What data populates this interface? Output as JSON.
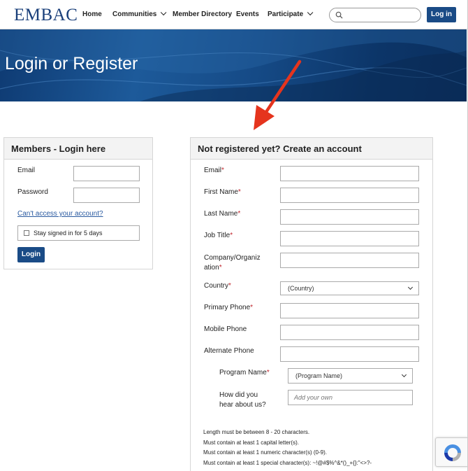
{
  "brand": {
    "logo_text": "EMBAC",
    "accent": "#1a4b86"
  },
  "nav": {
    "items": [
      {
        "label": "Home",
        "has_dropdown": false
      },
      {
        "label": "Communities",
        "has_dropdown": true
      },
      {
        "label": "Member Directory",
        "has_dropdown": false
      },
      {
        "label": "Events",
        "has_dropdown": false
      },
      {
        "label": "Participate",
        "has_dropdown": true
      }
    ],
    "search_placeholder": "",
    "login_button": "Log in"
  },
  "banner": {
    "title": "Login or Register"
  },
  "login_panel": {
    "title": "Members - Login here",
    "email_label": "Email",
    "password_label": "Password",
    "email_value": "",
    "password_value": "",
    "cant_access_link": "Can't access your account?",
    "stay_signed_in": "Stay signed in for 5 days",
    "stay_signed_in_checked": false,
    "login_button": "Login"
  },
  "register_panel": {
    "title": "Not registered yet? Create an account",
    "fields": [
      {
        "label": "Email",
        "required": true
      },
      {
        "label": "First Name",
        "required": true
      },
      {
        "label": "Last Name",
        "required": true
      },
      {
        "label": "Job Title",
        "required": true
      },
      {
        "label_line1": "Company/Organiz",
        "label_line2": "ation",
        "required": true
      },
      {
        "label": "Country",
        "required": true,
        "select_value": "(Country)"
      },
      {
        "label": "Primary Phone",
        "required": true
      },
      {
        "label": "Mobile Phone",
        "required": false
      },
      {
        "label": "Alternate Phone",
        "required": false
      }
    ],
    "program_name": {
      "label": "Program Name",
      "required": true,
      "select_value": "(Program Name)"
    },
    "how_heard": {
      "label_line1": "How did you",
      "label_line2": "hear about us?",
      "placeholder": "Add your own"
    },
    "password_rules": [
      "Length must be between 8 - 20 characters.",
      "Must contain at least 1 capital letter(s).",
      "Must contain at least 1 numeric character(s) (0-9).",
      "Must contain at least 1 special character(s): ~!@#$%^&*()_+{}:\"<>?-"
    ],
    "required_marker": "*"
  }
}
